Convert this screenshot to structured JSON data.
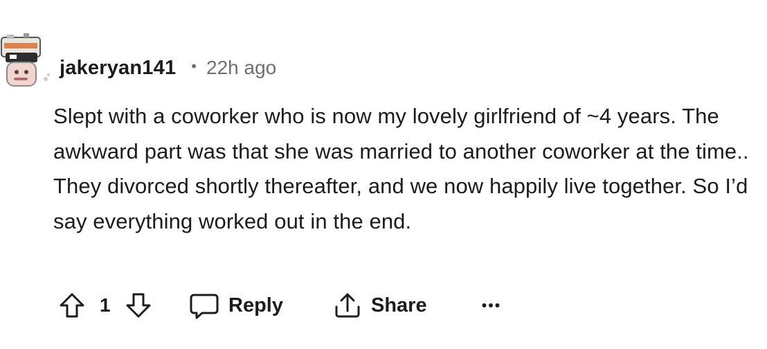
{
  "comment": {
    "author": "jakeryan141",
    "separator": "•",
    "timestamp": "22h ago",
    "body": "Slept with a coworker who is now my lovely girlfriend of ~4 years. The awkward part was that she was married to another coworker at the time.. They divorced shortly thereafter, and we now happily live together. So I’d say everything worked out in the end.",
    "vote_count": "1",
    "reply_label": "Reply",
    "share_label": "Share",
    "more_label": "•••"
  },
  "icons": {
    "upvote": "arrow-up-icon",
    "downvote": "arrow-down-icon",
    "reply": "speech-bubble-icon",
    "share": "share-upload-icon",
    "more": "ellipsis-icon"
  }
}
